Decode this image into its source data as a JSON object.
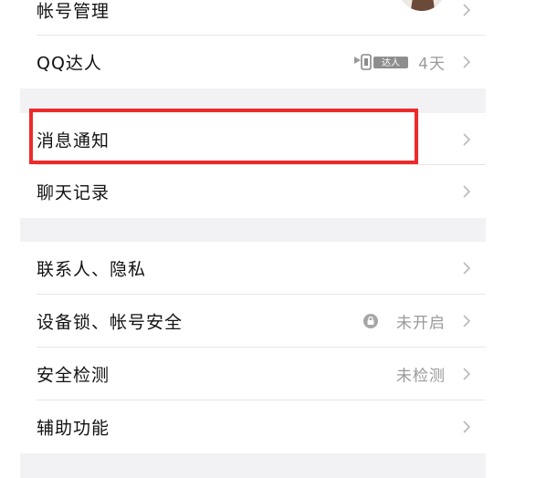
{
  "settings": {
    "account": {
      "label": "帐号管理"
    },
    "qq_daren": {
      "label": "QQ达人",
      "badge_text": "达人",
      "value": "4天"
    },
    "message_notify": {
      "label": "消息通知"
    },
    "chat_history": {
      "label": "聊天记录"
    },
    "contacts_privacy": {
      "label": "联系人、隐私"
    },
    "device_lock": {
      "label": "设备锁、帐号安全",
      "value": "未开启"
    },
    "security_check": {
      "label": "安全检测",
      "value": "未检测"
    },
    "accessibility": {
      "label": "辅助功能"
    }
  },
  "colors": {
    "highlight": "#ee2a2a",
    "section_gap": "#f2f2f4",
    "muted_text": "#9a9a9a"
  },
  "icons": {
    "chevron": "chevron-right-icon",
    "lock": "lock-icon",
    "badge": "qq-daren-badge-icon"
  }
}
